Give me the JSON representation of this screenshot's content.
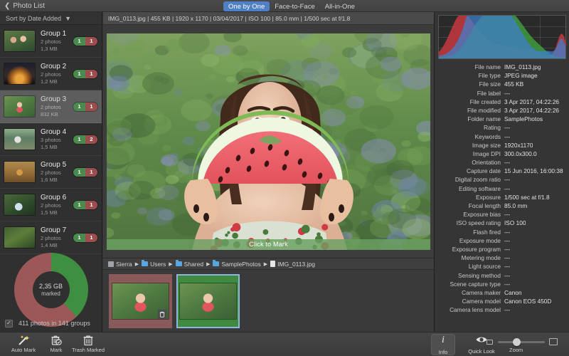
{
  "window": {
    "back_label": "Photo List",
    "back_icon": "chevron-left-icon"
  },
  "tabs": [
    {
      "label": "One by One",
      "active": true
    },
    {
      "label": "Face-to-Face",
      "active": false
    },
    {
      "label": "All-in-One",
      "active": false
    }
  ],
  "sidebar": {
    "sort_label": "Sort by Date Added",
    "sort_caret_icon": "chevron-down-icon",
    "groups": [
      {
        "title": "Group 1",
        "photos": "2 photos",
        "size": "1,3 MB",
        "keep": "1",
        "trash": "1",
        "selected": false
      },
      {
        "title": "Group 2",
        "photos": "2 photos",
        "size": "1,2 MB",
        "keep": "1",
        "trash": "1",
        "selected": false
      },
      {
        "title": "Group 3",
        "photos": "2 photos",
        "size": "832 KB",
        "keep": "1",
        "trash": "1",
        "selected": true
      },
      {
        "title": "Group 4",
        "photos": "3 photos",
        "size": "1,5 MB",
        "keep": "1",
        "trash": "2",
        "selected": false
      },
      {
        "title": "Group 5",
        "photos": "2 photos",
        "size": "1,6 MB",
        "keep": "1",
        "trash": "1",
        "selected": false
      },
      {
        "title": "Group 6",
        "photos": "2 photos",
        "size": "1,5 MB",
        "keep": "1",
        "trash": "1",
        "selected": false
      },
      {
        "title": "Group 7",
        "photos": "2 photos",
        "size": "1,4 MB",
        "keep": "1",
        "trash": "1",
        "selected": false
      }
    ],
    "donut": {
      "amount": "2,35 GB",
      "caption": "marked",
      "marked_color": "#9c5858",
      "keep_color": "#3f8f42",
      "marked_percent": 62,
      "keep_percent": 38
    },
    "status_text": "411 photos in 141 groups",
    "status_checkbox_icon": "checkbox-icon",
    "status_checkbox_checked": true
  },
  "center": {
    "meta_strip": "IMG_0113.jpg  |  455 KB  |  1920 x 1170  |  03/04/2017  |  ISO 100  |  85.0 mm  |  1/500 sec at f/1.8",
    "mark_overlay_label": "Click to Mark",
    "breadcrumb": [
      {
        "label": "Sierra",
        "icon": "disk-icon"
      },
      {
        "label": "Users",
        "icon": "folder-icon"
      },
      {
        "label": "Shared",
        "icon": "folder-icon"
      },
      {
        "label": "SamplePhotos",
        "icon": "folder-icon"
      },
      {
        "label": "IMG_0113.jpg",
        "icon": "document-icon"
      }
    ],
    "thumbnails": [
      {
        "state": "marked",
        "current": false,
        "trash_icon": "trash-icon"
      },
      {
        "state": "keep",
        "current": true,
        "trash_icon": null
      }
    ]
  },
  "inspector": {
    "histogram": {
      "title": "histogram",
      "channels": [
        "red",
        "green",
        "blue"
      ]
    },
    "rows": [
      {
        "label": "File name",
        "value": "IMG_0113.jpg"
      },
      {
        "label": "File type",
        "value": "JPEG image"
      },
      {
        "label": "File size",
        "value": "455 KB"
      },
      {
        "label": "File label",
        "value": "---"
      },
      {
        "label": "File created",
        "value": "3 Apr 2017, 04:22:26"
      },
      {
        "label": "File modified",
        "value": "3 Apr 2017, 04:22:26"
      },
      {
        "label": "Folder name",
        "value": "SamplePhotos"
      },
      {
        "label": "Rating",
        "value": "---"
      },
      {
        "label": "Keywords",
        "value": "---"
      },
      {
        "label": "Image size",
        "value": "1920x1170"
      },
      {
        "label": "Image DPI",
        "value": "300.0x300.0"
      },
      {
        "label": "Orientation",
        "value": "---"
      },
      {
        "label": "Capture date",
        "value": "15 Jun 2016, 16:00:38"
      },
      {
        "label": "Digital zoom ratio",
        "value": "---"
      },
      {
        "label": "Editing software",
        "value": "---"
      },
      {
        "label": "Exposure",
        "value": "1/500 sec at f/1.8"
      },
      {
        "label": "Focal length",
        "value": "85.0 mm"
      },
      {
        "label": "Exposure bias",
        "value": "---"
      },
      {
        "label": "ISO speed rating",
        "value": "ISO 100"
      },
      {
        "label": "Flash fired",
        "value": "---"
      },
      {
        "label": "Exposure mode",
        "value": "---"
      },
      {
        "label": "Exposure program",
        "value": "---"
      },
      {
        "label": "Metering mode",
        "value": "---"
      },
      {
        "label": "Light source",
        "value": "---"
      },
      {
        "label": "Sensing method",
        "value": "---"
      },
      {
        "label": "Scene capture type",
        "value": "---"
      },
      {
        "label": "Camera maker",
        "value": "Canon"
      },
      {
        "label": "Camera model",
        "value": "Canon EOS 450D"
      },
      {
        "label": "Camera lens model",
        "value": "---"
      }
    ]
  },
  "toolbar": {
    "auto_mark": {
      "label": "Auto Mark",
      "icon": "magic-wand-icon"
    },
    "mark": {
      "label": "Mark",
      "icon": "trash-check-icon"
    },
    "trash_marked": {
      "label": "Trash Marked",
      "icon": "trash-icon"
    },
    "info": {
      "label": "Info",
      "icon": "info-icon",
      "pressed": true
    },
    "quick_look": {
      "label": "Quick Look",
      "icon": "eye-icon",
      "pressed": false
    },
    "zoom": {
      "label": "Zoom",
      "value": 40,
      "small_icon": "small-image-icon",
      "large_icon": "large-image-icon"
    }
  }
}
